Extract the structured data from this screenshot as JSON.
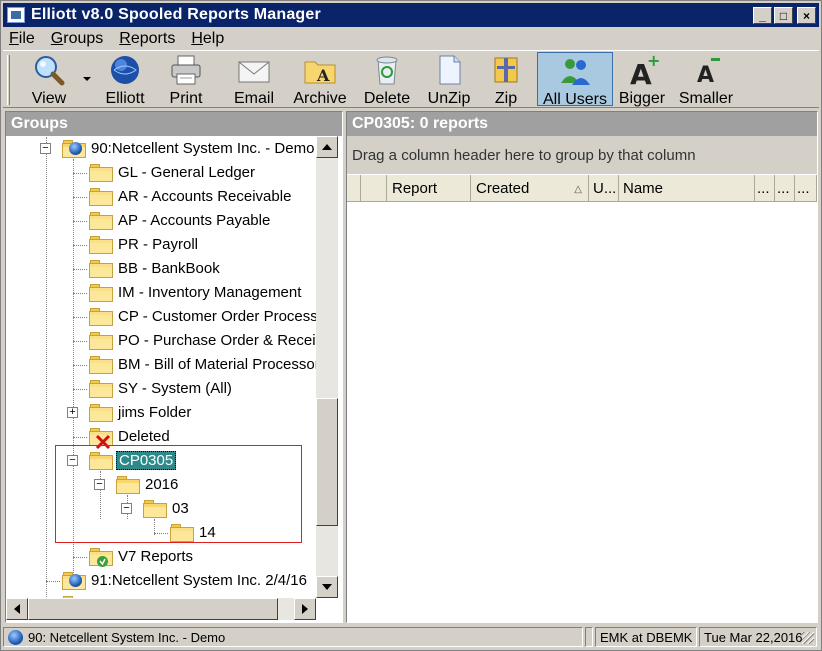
{
  "window": {
    "title": "Elliott v8.0 Spooled Reports Manager",
    "controls": [
      "_",
      "□",
      "×"
    ]
  },
  "menu": [
    {
      "label": "File",
      "accel": "F"
    },
    {
      "label": "Groups",
      "accel": "G"
    },
    {
      "label": "Reports",
      "accel": "R"
    },
    {
      "label": "Help",
      "accel": "H"
    }
  ],
  "toolbar": {
    "view": "View",
    "elliott": "Elliott",
    "print": "Print",
    "email": "Email",
    "archive": "Archive",
    "delete": "Delete",
    "unzip": "UnZip",
    "zip": "Zip",
    "all_users": "All Users",
    "bigger": "Bigger",
    "smaller": "Smaller"
  },
  "groups": {
    "header": "Groups",
    "tree": [
      {
        "label": "90:Netcellent System Inc. - Demo",
        "expander": "−",
        "icon": "globe-icon"
      },
      {
        "label": "GL - General Ledger"
      },
      {
        "label": "AR - Accounts Receivable"
      },
      {
        "label": "AP - Accounts Payable"
      },
      {
        "label": "PR - Payroll"
      },
      {
        "label": "BB - BankBook"
      },
      {
        "label": "IM - Inventory Management"
      },
      {
        "label": "CP - Customer Order Processing"
      },
      {
        "label": "PO - Purchase Order & Receiving"
      },
      {
        "label": "BM - Bill of Material Processor"
      },
      {
        "label": "SY - System (All)"
      },
      {
        "label": "jims Folder",
        "expander": "+"
      },
      {
        "label": "Deleted",
        "icon": "deleted-folder-icon"
      },
      {
        "label": "CP0305",
        "expander": "−",
        "selected": true
      },
      {
        "label": "2016",
        "expander": "−"
      },
      {
        "label": "03",
        "expander": "−"
      },
      {
        "label": "14"
      },
      {
        "label": "V7 Reports",
        "icon": "v7-folder-icon"
      },
      {
        "label": "91:Netcellent System Inc. 2/4/16",
        "icon": "globe-icon"
      }
    ]
  },
  "reports": {
    "header": "CP0305:  0 reports",
    "group_hint": "Drag a column header here to group by that column",
    "columns": [
      "",
      "",
      "Report",
      "Created",
      "U...",
      "Name",
      "...",
      "...",
      "..."
    ],
    "sort_indicator": "△"
  },
  "status": {
    "company": "90: Netcellent System Inc. - Demo",
    "user": "EMK at DBEMK",
    "date": "Tue Mar 22,2016"
  }
}
